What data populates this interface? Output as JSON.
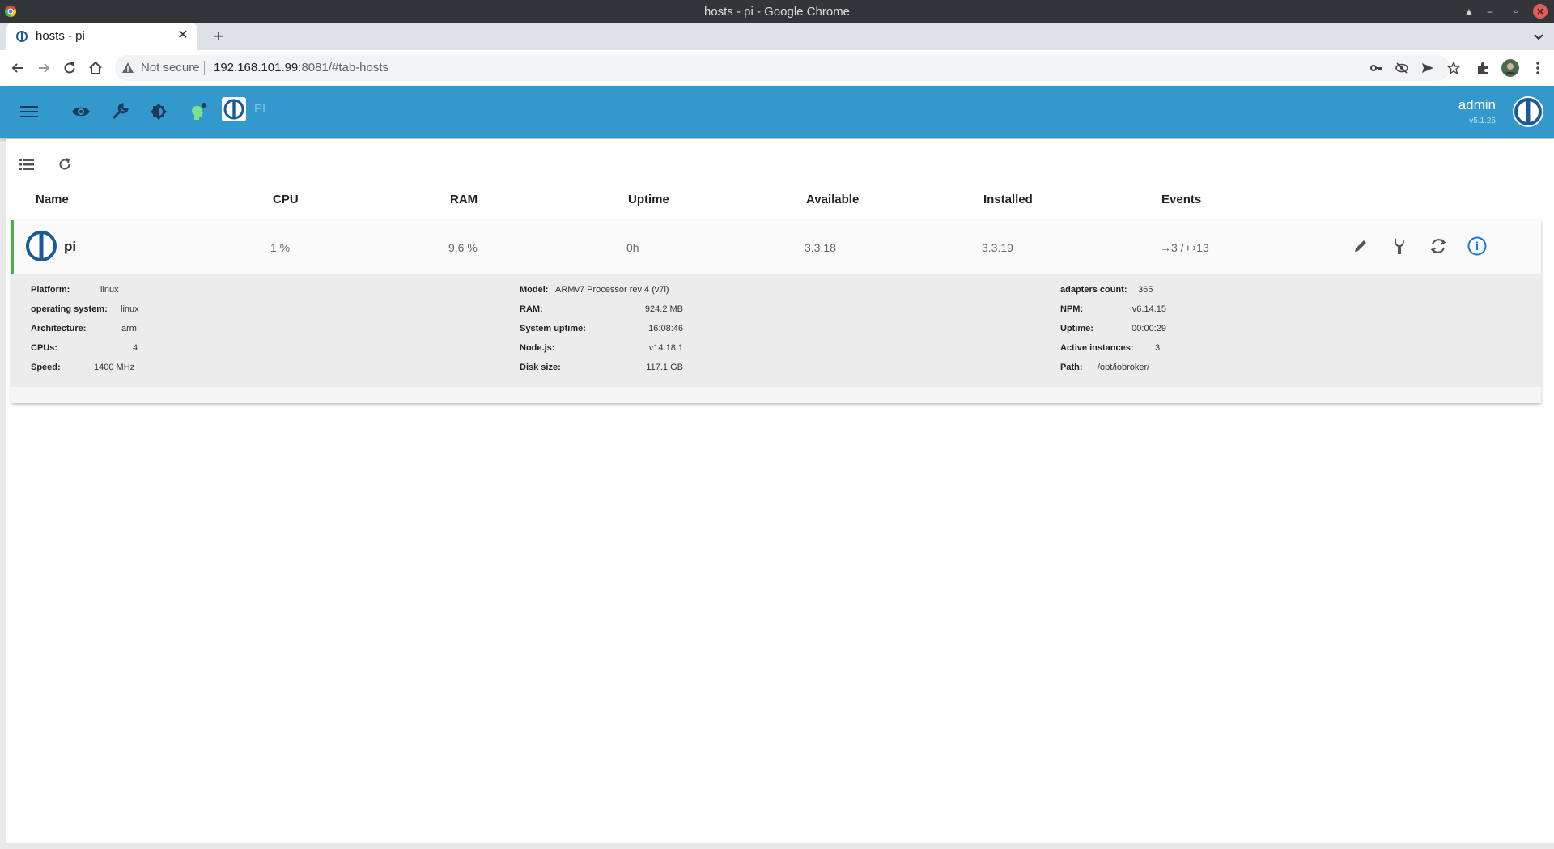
{
  "os": {
    "window_title": "hosts - pi - Google Chrome"
  },
  "browser": {
    "tab_title": "hosts - pi",
    "security_text": "Not secure",
    "url_host": "192.168.101.99",
    "url_rest": ":8081/#tab-hosts"
  },
  "header": {
    "host_name": "PI",
    "user_name": "admin",
    "version": "v5.1.25",
    "accent_color": "#3399cc"
  },
  "table": {
    "columns": [
      "Name",
      "CPU",
      "RAM",
      "Uptime",
      "Available",
      "Installed",
      "Events"
    ],
    "row": {
      "name": "pi",
      "cpu": "1 %",
      "ram": "9,6 %",
      "uptime": "0h",
      "available": "3.3.18",
      "installed": "3.3.19",
      "events": "→3 / ↦13"
    }
  },
  "details": {
    "col1": [
      {
        "label": "Platform:",
        "value": "linux"
      },
      {
        "label": "operating system:",
        "value": "linux"
      },
      {
        "label": "Architecture:",
        "value": "arm"
      },
      {
        "label": "CPUs:",
        "value": "4"
      },
      {
        "label": "Speed:",
        "value": "1400 MHz"
      }
    ],
    "col2": [
      {
        "label": "Model:",
        "value": "ARMv7 Processor rev 4 (v7l)"
      },
      {
        "label": "RAM:",
        "value": "924.2 MB"
      },
      {
        "label": "System uptime:",
        "value": "16:08:46"
      },
      {
        "label": "Node.js:",
        "value": "v14.18.1"
      },
      {
        "label": "Disk size:",
        "value": "117.1 GB"
      }
    ],
    "col3": [
      {
        "label": "adapters count:",
        "value": "365"
      },
      {
        "label": "NPM:",
        "value": "v6.14.15"
      },
      {
        "label": "Uptime:",
        "value": "00:00:29"
      },
      {
        "label": "Active instances:",
        "value": "3"
      },
      {
        "label": "Path:",
        "value": "/opt/iobroker/"
      }
    ]
  }
}
